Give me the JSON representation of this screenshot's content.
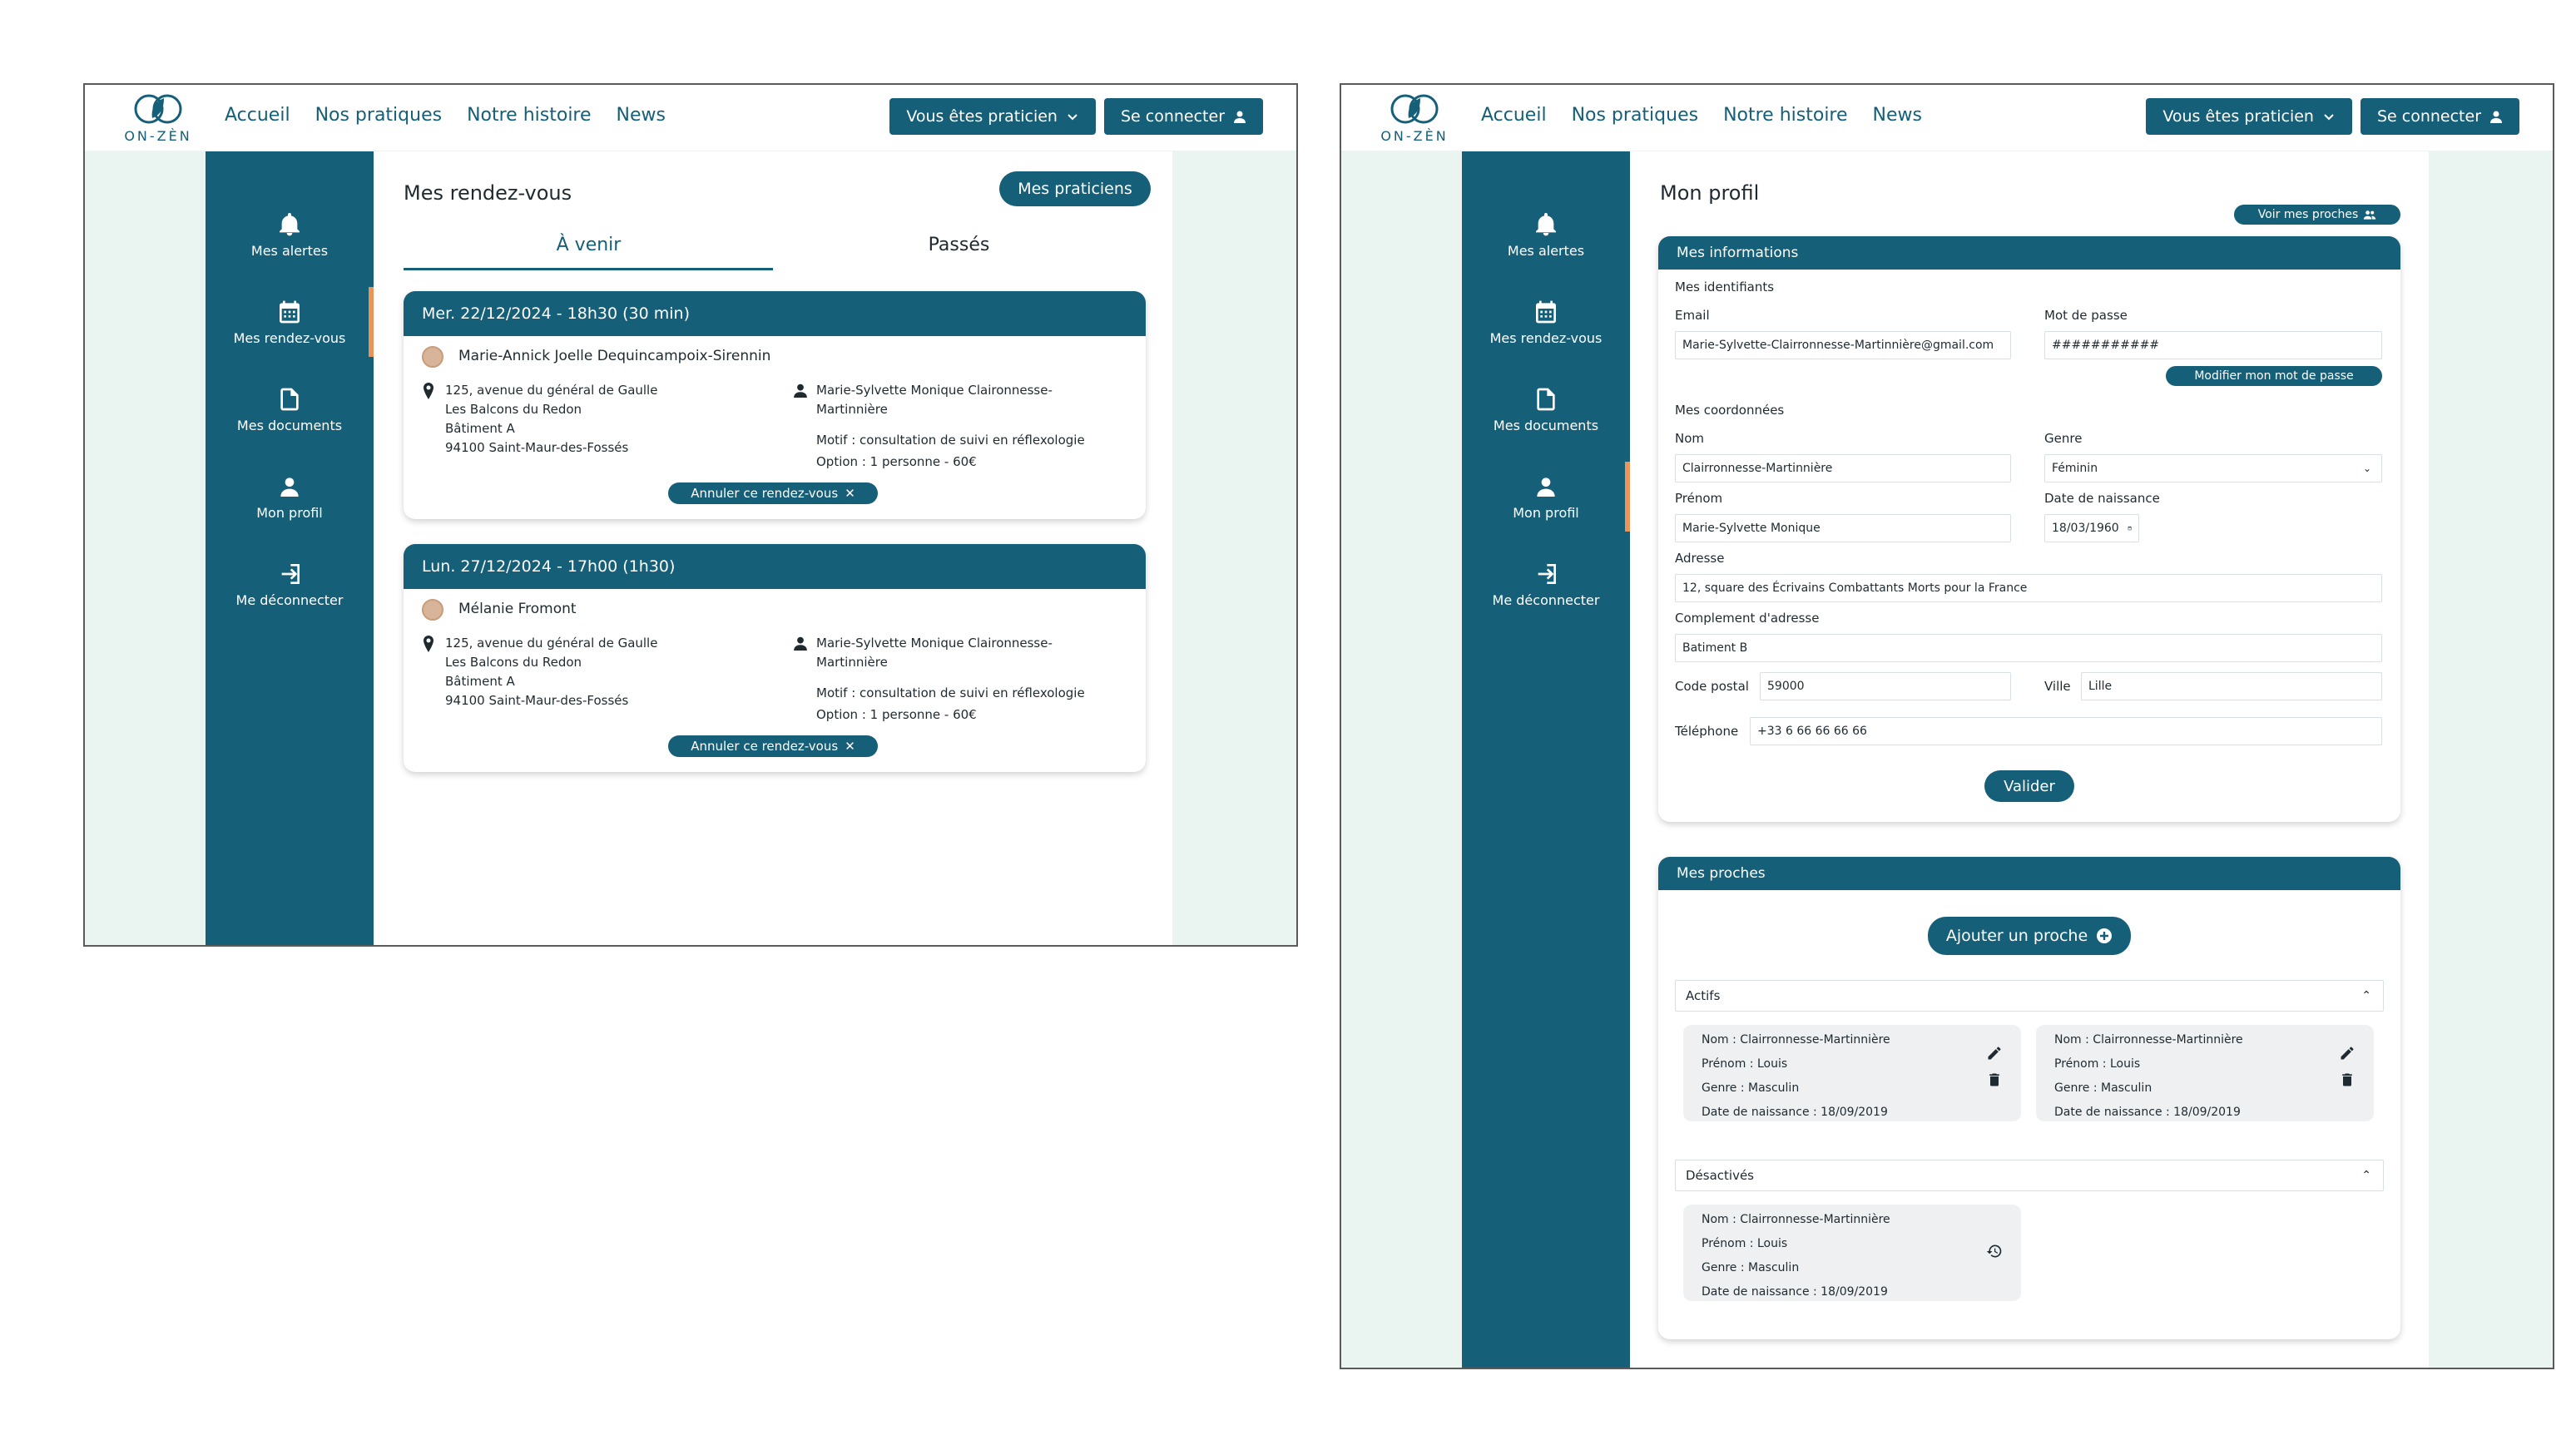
{
  "header": {
    "logo_text": "ON-ZÈN",
    "nav": [
      "Accueil",
      "Nos pratiques",
      "Notre histoire",
      "News"
    ],
    "practitioner_button": "Vous êtes praticien",
    "login_button": "Se connecter"
  },
  "sidebar": {
    "items": [
      {
        "label": "Mes alertes",
        "icon": "bell-icon"
      },
      {
        "label": "Mes rendez-vous",
        "icon": "calendar-icon"
      },
      {
        "label": "Mes documents",
        "icon": "document-icon"
      },
      {
        "label": "Mon profil",
        "icon": "user-icon"
      },
      {
        "label": "Me déconnecter",
        "icon": "logout-icon"
      }
    ]
  },
  "rdv": {
    "title": "Mes rendez-vous",
    "praticiens_button": "Mes praticiens",
    "tabs": [
      "À venir",
      "Passés"
    ],
    "appointments": [
      {
        "date": "Mer. 22/12/2024 - 18h30 (30 min)",
        "patient": "Marie-Annick Joelle Dequincampoix-Sirennin",
        "address": [
          "125, avenue du général de Gaulle",
          "Les Balcons du Redon",
          "Bâtiment A",
          "94100 Saint-Maur-des-Fossés"
        ],
        "practitioner": [
          "Marie-Sylvette Monique Claironnesse-",
          "Martinnière"
        ],
        "motif": "Motif : consultation de suivi en réflexologie",
        "option": "Option : 1 personne - 60€",
        "cancel": "Annuler ce rendez-vous"
      },
      {
        "date": "Lun. 27/12/2024 - 17h00 (1h30)",
        "patient": "Mélanie Fromont",
        "address": [
          "125, avenue du général de Gaulle",
          "Les Balcons du Redon",
          "Bâtiment A",
          "94100 Saint-Maur-des-Fossés"
        ],
        "practitioner": [
          "Marie-Sylvette Monique Claironnesse-",
          "Martinnière"
        ],
        "motif": "Motif : consultation de suivi en réflexologie",
        "option": "Option : 1 personne - 60€",
        "cancel": "Annuler ce rendez-vous"
      }
    ]
  },
  "profil": {
    "title": "Mon profil",
    "voir_proches": "Voir mes proches",
    "infos_header": "Mes informations",
    "identifiants_title": "Mes identifiants",
    "email_label": "Email",
    "email_value": "Marie-Sylvette-Clairronnesse-Martinnière@gmail.com",
    "password_label": "Mot de passe",
    "password_value": "###########",
    "change_password": "Modifier mon mot de passe",
    "coordonnees_title": "Mes coordonnées",
    "nom_label": "Nom",
    "nom_value": "Clairronnesse-Martinnière",
    "genre_label": "Genre",
    "genre_value": "Féminin",
    "prenom_label": "Prénom",
    "prenom_value": "Marie-Sylvette Monique",
    "ddn_label": "Date de naissance",
    "ddn_value": "18/03/1960",
    "adresse_label": "Adresse",
    "adresse_value": "12, square des Écrivains Combattants Morts pour la France",
    "complement_label": "Complement d'adresse",
    "complement_value": "Batiment B",
    "cp_label": "Code postal",
    "cp_value": "59000",
    "ville_label": "Ville",
    "ville_value": "Lille",
    "tel_label": "Téléphone",
    "tel_value": "+33 6 66 66 66 66",
    "valider": "Valider",
    "proches_header": "Mes proches",
    "ajouter_proche": "Ajouter un proche",
    "actifs_label": "Actifs",
    "desactives_label": "Désactivés",
    "actifs": [
      {
        "nom": "Nom : Clairronnesse-Martinnière",
        "prenom": "Prénom : Louis",
        "genre": "Genre : Masculin",
        "ddn": "Date de naissance : 18/09/2019"
      },
      {
        "nom": "Nom : Clairronnesse-Martinnière",
        "prenom": "Prénom : Louis",
        "genre": "Genre : Masculin",
        "ddn": "Date de naissance : 18/09/2019"
      }
    ],
    "desactives": [
      {
        "nom": "Nom : Clairronnesse-Martinnière",
        "prenom": "Prénom : Louis",
        "genre": "Genre : Masculin",
        "ddn": "Date de naissance : 18/09/2019"
      }
    ]
  }
}
